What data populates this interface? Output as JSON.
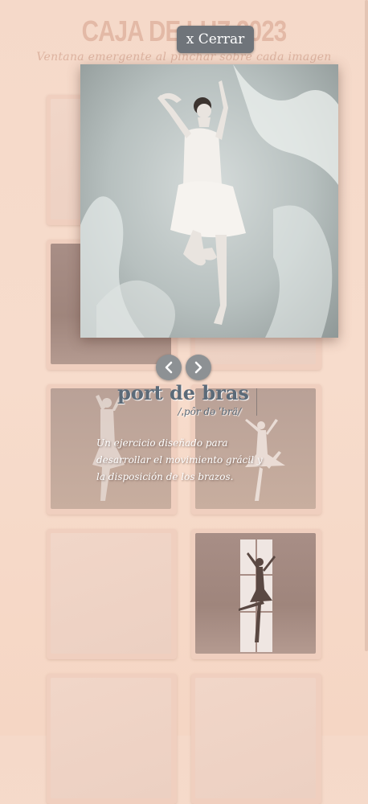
{
  "page": {
    "title": "CAJA DE LUZ 2023",
    "subtitle": "Ventana emergente al pinchar sobre cada imagen"
  },
  "lightbox": {
    "close_label": "x Cerrar",
    "term": "port de bras",
    "phonetic": "/ˌpôr də ˈbrä/",
    "description": "Un ejercicio diseñado para desarrollar el movimiento grácil y la disposición de los brazos."
  },
  "gallery": {
    "thumbnails": [
      {
        "tone": "light"
      },
      {
        "tone": "light"
      },
      {
        "tone": "dark"
      },
      {
        "tone": "light"
      },
      {
        "tone": "mid"
      },
      {
        "tone": "dark"
      },
      {
        "tone": "light"
      },
      {
        "tone": "dark"
      },
      {
        "tone": "light"
      },
      {
        "tone": "light"
      }
    ]
  },
  "icons": {
    "prev": "chevron-left-icon",
    "next": "chevron-right-icon"
  },
  "colors": {
    "background": "#f7dccc",
    "button": "#6f747a",
    "caption_title": "#5b6a78"
  }
}
